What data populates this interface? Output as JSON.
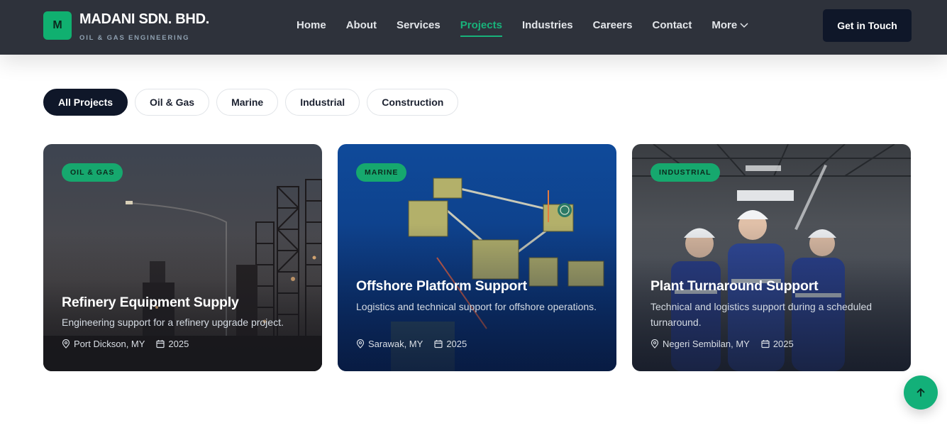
{
  "brand": {
    "logo_letter": "M",
    "name": "MADANI SDN. BHD.",
    "tagline": "OIL & GAS ENGINEERING"
  },
  "nav": {
    "items": [
      {
        "label": "Home"
      },
      {
        "label": "About"
      },
      {
        "label": "Services"
      },
      {
        "label": "Projects",
        "active": true
      },
      {
        "label": "Industries"
      },
      {
        "label": "Careers"
      },
      {
        "label": "Contact"
      },
      {
        "label": "More"
      }
    ],
    "cta_label": "Get in Touch"
  },
  "filters": [
    {
      "label": "All Projects",
      "active": true
    },
    {
      "label": "Oil & Gas"
    },
    {
      "label": "Marine"
    },
    {
      "label": "Industrial"
    },
    {
      "label": "Construction"
    }
  ],
  "projects": [
    {
      "category": "OIL & GAS",
      "title": "Refinery Equipment Supply",
      "description": "Engineering support for a refinery upgrade project.",
      "location": "Port Dickson, MY",
      "year": "2025"
    },
    {
      "category": "MARINE",
      "title": "Offshore Platform Support",
      "description": "Logistics and technical support for offshore operations.",
      "location": "Sarawak, MY",
      "year": "2025"
    },
    {
      "category": "INDUSTRIAL",
      "title": "Plant Turnaround Support",
      "description": "Technical and logistics support during a scheduled turnaround.",
      "location": "Negeri Sembilan, MY",
      "year": "2025"
    }
  ],
  "colors": {
    "header_bg": "#2e323b",
    "accent": "#18b27a",
    "dark": "#0f1729"
  },
  "icons": {
    "location": "map-pin-icon",
    "date": "calendar-icon",
    "back_to_top": "arrow-up-icon"
  }
}
